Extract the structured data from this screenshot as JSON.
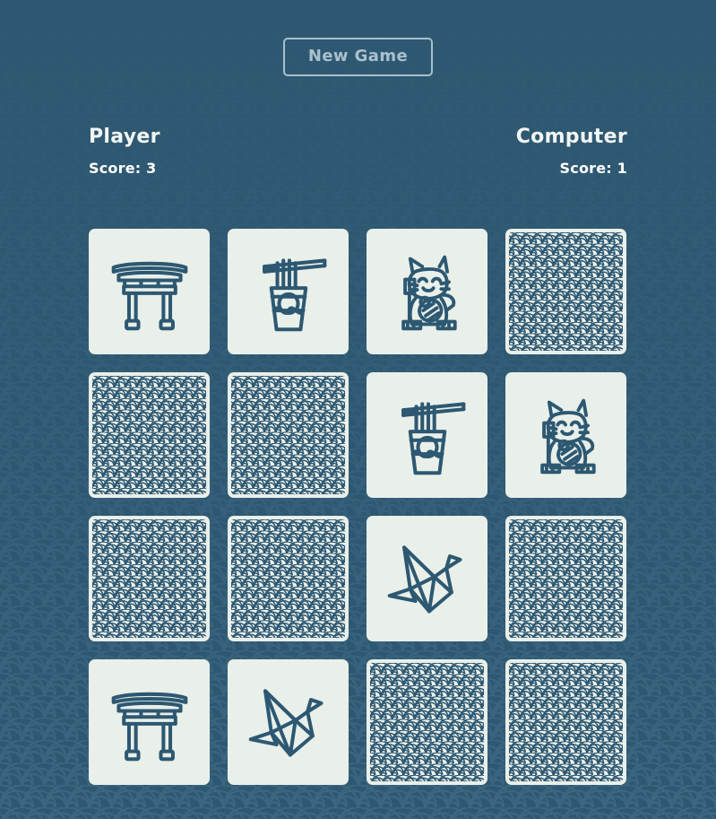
{
  "app": {
    "title": "Memory Match Game",
    "background_color": "#2e5871",
    "card_face_color": "#e9efe9",
    "ink_color": "#2d5872",
    "accent_text_color": "#a9c0cd"
  },
  "toolbar": {
    "new_game_label": "New Game"
  },
  "scoreboard": {
    "player": {
      "name": "Player",
      "score_label": "Score: 3"
    },
    "computer": {
      "name": "Computer",
      "score_label": "Score: 1"
    }
  },
  "board": {
    "rows": 4,
    "columns": 4,
    "cards": [
      {
        "index": 0,
        "state": "face-up",
        "icon": "torii-gate-icon"
      },
      {
        "index": 1,
        "state": "face-up",
        "icon": "noodle-cup-icon"
      },
      {
        "index": 2,
        "state": "face-up",
        "icon": "lucky-cat-icon"
      },
      {
        "index": 3,
        "state": "face-down",
        "icon": "wave-pattern-icon"
      },
      {
        "index": 4,
        "state": "face-down",
        "icon": "wave-pattern-icon"
      },
      {
        "index": 5,
        "state": "face-down",
        "icon": "wave-pattern-icon"
      },
      {
        "index": 6,
        "state": "face-up",
        "icon": "noodle-cup-icon"
      },
      {
        "index": 7,
        "state": "face-up",
        "icon": "lucky-cat-icon"
      },
      {
        "index": 8,
        "state": "face-down",
        "icon": "wave-pattern-icon"
      },
      {
        "index": 9,
        "state": "face-down",
        "icon": "wave-pattern-icon"
      },
      {
        "index": 10,
        "state": "face-up",
        "icon": "origami-crane-icon"
      },
      {
        "index": 11,
        "state": "face-down",
        "icon": "wave-pattern-icon"
      },
      {
        "index": 12,
        "state": "face-up",
        "icon": "torii-gate-icon"
      },
      {
        "index": 13,
        "state": "face-up",
        "icon": "origami-crane-icon"
      },
      {
        "index": 14,
        "state": "face-down",
        "icon": "wave-pattern-icon"
      },
      {
        "index": 15,
        "state": "face-down",
        "icon": "wave-pattern-icon"
      }
    ]
  }
}
